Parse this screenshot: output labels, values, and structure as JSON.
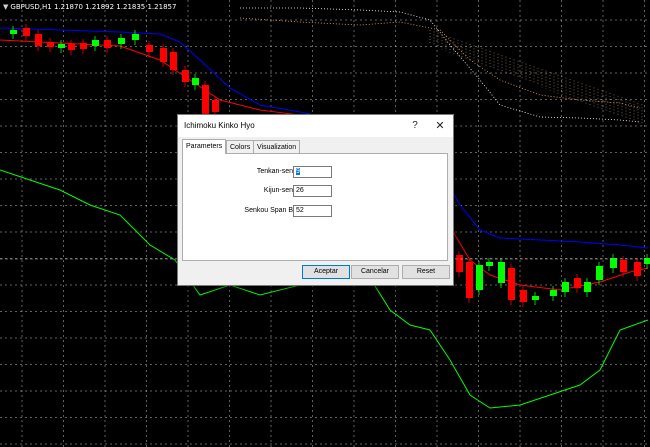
{
  "chart": {
    "symbol": "GBPUSD,H1  1.21870 1.21892 1.21835 1.21857",
    "colors": {
      "background": "#000000",
      "grid": "#ffffff",
      "bull": "#00ff00",
      "bear": "#ff0000",
      "tenkan": "#ff0000",
      "kijun": "#0000ff",
      "chikou": "#00ff00",
      "senkou_a": "#f4a460",
      "senkou_b": "#ffffff"
    }
  },
  "dialog": {
    "title": "Ichimoku Kinko Hyo",
    "help_icon": "?",
    "close_icon": "✕",
    "tabs": [
      "Parameters",
      "Colors",
      "Visualization"
    ],
    "active_tab": "Parameters",
    "fields": [
      {
        "label": "Tenkan-sen:",
        "value": "9"
      },
      {
        "label": "Kijun-sen:",
        "value": "26"
      },
      {
        "label": "Senkou Span B:",
        "value": "52"
      }
    ],
    "buttons": {
      "ok": "Aceptar",
      "cancel": "Cancelar",
      "reset": "Reset"
    }
  }
}
